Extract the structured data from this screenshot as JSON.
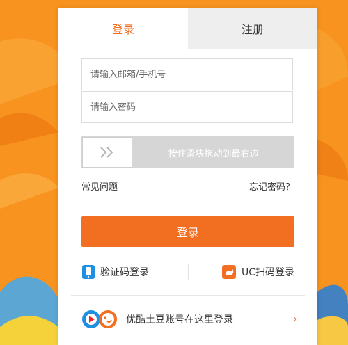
{
  "tabs": {
    "login": "登录",
    "register": "注册"
  },
  "form": {
    "account_placeholder": "请输入邮箱/手机号",
    "password_placeholder": "请输入密码"
  },
  "slider": {
    "hint": "按住滑块拖动到最右边",
    "handle_icon": "double-chevron-right-icon"
  },
  "links": {
    "faq": "常见问题",
    "forgot": "忘记密码？"
  },
  "login_button": "登录",
  "alt_login": {
    "sms": {
      "label": "验证码登录",
      "icon": "phone-icon",
      "color": "#1e8fe1"
    },
    "uc": {
      "label": "UC扫码登录",
      "icon": "uc-squirrel-icon",
      "color": "#f26e21"
    }
  },
  "partner": {
    "label": "优酷土豆账号在这里登录",
    "arrow": "›"
  },
  "colors": {
    "accent": "#f26e21",
    "background": "#f7941d",
    "tab_inactive": "#eeeeee",
    "slider": "#d6d6d6"
  }
}
